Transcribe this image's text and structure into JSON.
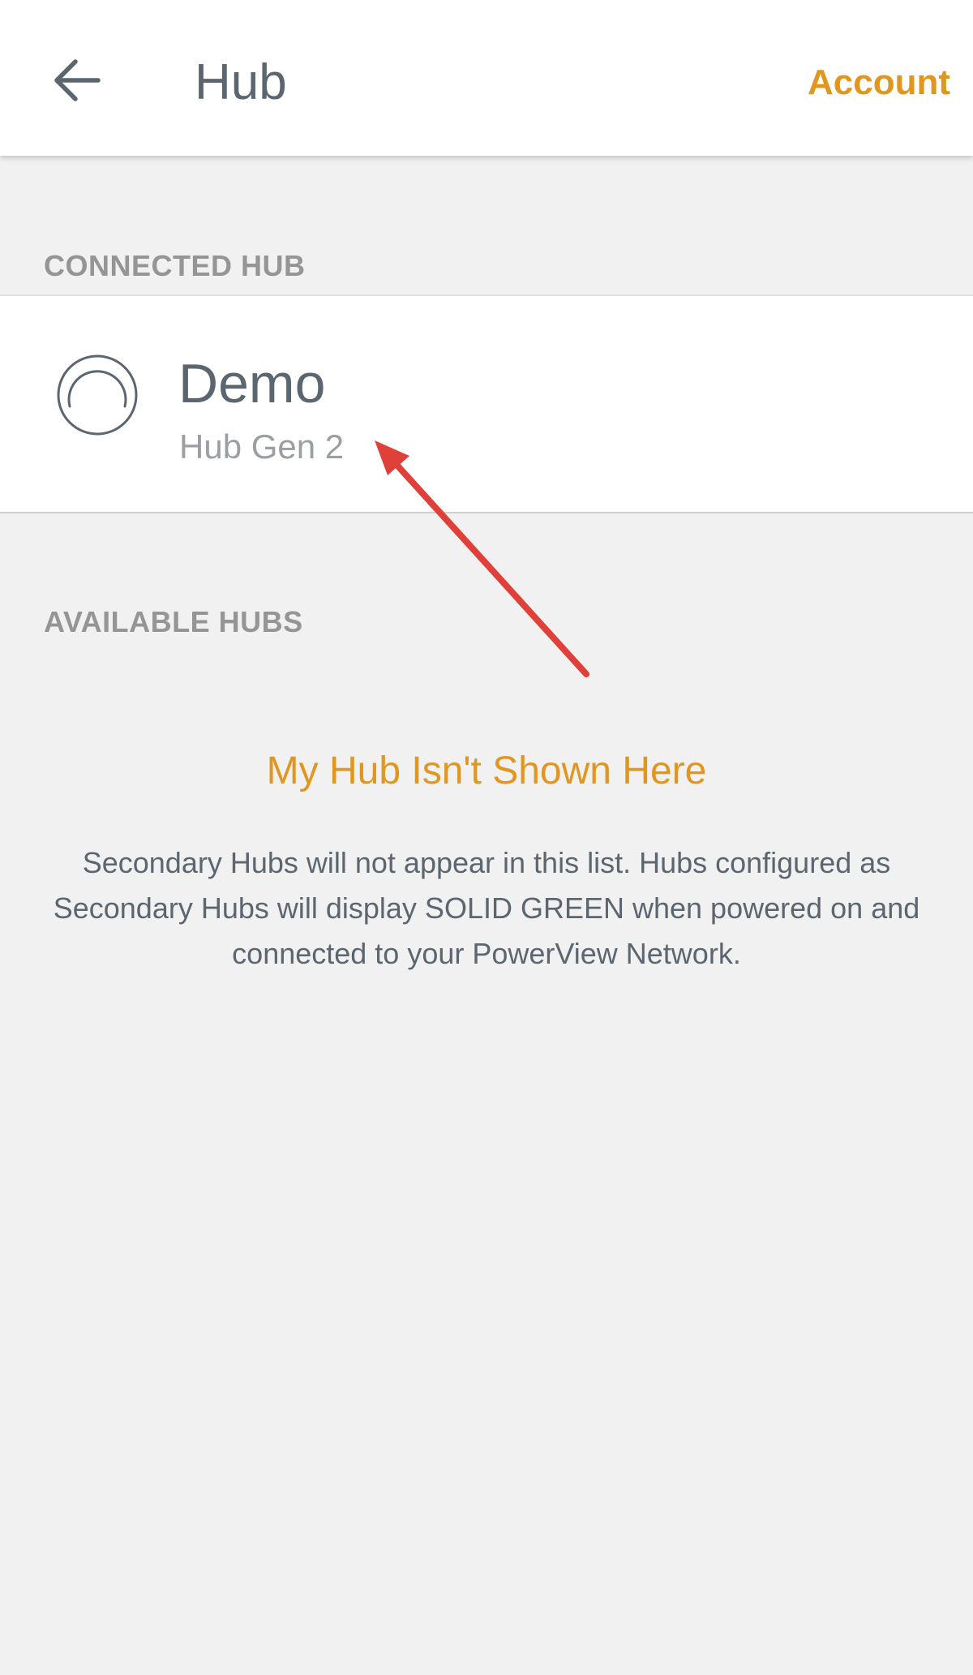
{
  "header": {
    "title": "Hub",
    "account_label": "Account",
    "back_icon": "arrow-left-icon"
  },
  "connected_section": {
    "label": "CONNECTED HUB",
    "hub": {
      "name": "Demo",
      "model": "Hub Gen 2",
      "status_icon": "hub-connection-ring-icon"
    }
  },
  "available_section": {
    "label": "AVAILABLE HUBS",
    "missing_link": "My Hub Isn't Shown Here",
    "help_text": "Secondary Hubs will not appear in this list. Hubs configured as Secondary Hubs will display SOLID GREEN when powered on and connected to your PowerView Network."
  },
  "colors": {
    "accent": "#e0961f",
    "text_primary": "#5c6670",
    "text_secondary": "#959595",
    "background": "#f1f1f1",
    "card": "#ffffff",
    "annotation_arrow": "#e0403a"
  }
}
